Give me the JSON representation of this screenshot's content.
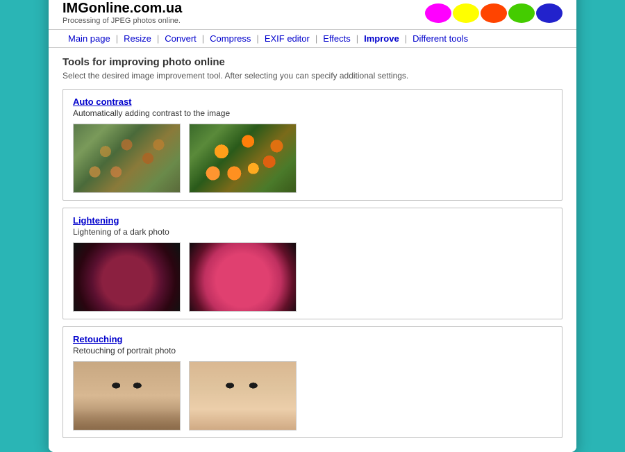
{
  "window": {
    "titlebar": {
      "dots": [
        "red",
        "yellow",
        "green"
      ]
    }
  },
  "header": {
    "site_title": "IMGonline.com.ua",
    "site_subtitle": "Processing of JPEG photos online.",
    "color_blobs": [
      {
        "color": "#ff00ff",
        "label": "magenta-blob"
      },
      {
        "color": "#ffff00",
        "label": "yellow-blob"
      },
      {
        "color": "#ff4400",
        "label": "red-blob"
      },
      {
        "color": "#44cc00",
        "label": "green-blob"
      },
      {
        "color": "#2222cc",
        "label": "blue-blob"
      }
    ]
  },
  "nav": {
    "items": [
      {
        "label": "Main page",
        "active": false
      },
      {
        "label": "Resize",
        "active": false
      },
      {
        "label": "Convert",
        "active": false
      },
      {
        "label": "Compress",
        "active": false
      },
      {
        "label": "EXIF editor",
        "active": false
      },
      {
        "label": "Effects",
        "active": false
      },
      {
        "label": "Improve",
        "active": true
      },
      {
        "label": "Different tools",
        "active": false
      }
    ]
  },
  "main": {
    "heading": "Tools for improving photo online",
    "description": "Select the desired image improvement tool. After selecting you can specify additional settings.",
    "tools": [
      {
        "id": "auto-contrast",
        "link_label": "Auto contrast",
        "description": "Automatically adding contrast to the image"
      },
      {
        "id": "lightening",
        "link_label": "Lightening",
        "description": "Lightening of a dark photo"
      },
      {
        "id": "retouching",
        "link_label": "Retouching",
        "description": "Retouching of portrait photo"
      }
    ]
  }
}
